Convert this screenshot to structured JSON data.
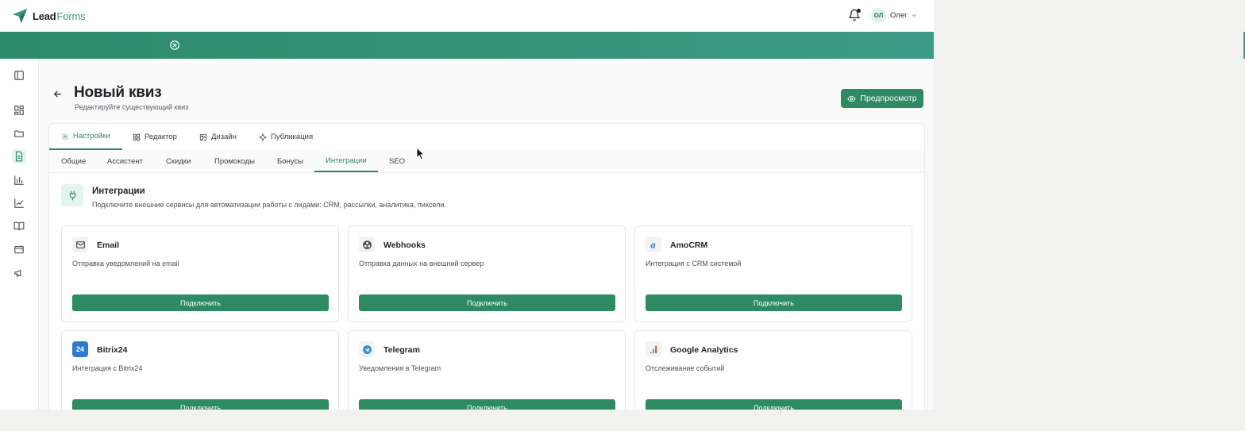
{
  "app": {
    "logo": {
      "part1": "Lead",
      "part2": "Forms"
    },
    "user": {
      "initials": "ОЛ",
      "name": "Олег"
    },
    "colors": {
      "accent": "#2e8a63",
      "banner": "#3b9b86"
    }
  },
  "sidebar": {
    "items": [
      {
        "icon": "sidebar-toggle-icon"
      },
      {
        "icon": "dashboard-icon"
      },
      {
        "icon": "folder-icon"
      },
      {
        "icon": "document-icon",
        "active": true
      },
      {
        "icon": "bar-chart-icon"
      },
      {
        "icon": "line-chart-icon"
      },
      {
        "icon": "book-icon"
      },
      {
        "icon": "wallet-icon"
      },
      {
        "icon": "megaphone-icon"
      }
    ]
  },
  "header": {
    "title": "Новый квиз",
    "subtitle": "Редактируйте существующий квиз",
    "preview_label": "Предпросмотр"
  },
  "tabs": [
    {
      "label": "Настройки",
      "icon": "gear-icon",
      "active": true
    },
    {
      "label": "Редактор",
      "icon": "grid-icon"
    },
    {
      "label": "Дизайн",
      "icon": "image-icon"
    },
    {
      "label": "Публикация",
      "icon": "publish-icon"
    }
  ],
  "subtabs": [
    {
      "label": "Общие"
    },
    {
      "label": "Ассистент"
    },
    {
      "label": "Скидки"
    },
    {
      "label": "Промокоды"
    },
    {
      "label": "Бонусы"
    },
    {
      "label": "Интеграции",
      "active": true
    },
    {
      "label": "SEO"
    }
  ],
  "section": {
    "title": "Интеграции",
    "description": "Подключите внешние сервисы для автоматизации работы с лидами: CRM, рассылки, аналитика, пиксели."
  },
  "integrations": [
    {
      "name": "Email",
      "description": "Отправка уведомлений на email",
      "button": "Подключить",
      "icon": "mail-icon"
    },
    {
      "name": "Webhooks",
      "description": "Отправка данных на внешний сервер",
      "button": "Подключить",
      "icon": "webhook-icon"
    },
    {
      "name": "AmoCRM",
      "description": "Интеграция с CRM системой",
      "button": "Подключить",
      "icon": "amocrm-icon"
    },
    {
      "name": "Bitrix24",
      "description": "Интеграция с Bitrix24",
      "button": "Подключить",
      "icon": "bitrix24-icon",
      "icon_text": "24"
    },
    {
      "name": "Telegram",
      "description": "Уведомления в Telegram",
      "button": "Подключить",
      "icon": "telegram-icon"
    },
    {
      "name": "Google Analytics",
      "description": "Отслеживание событий",
      "button": "Подключить",
      "icon": "google-analytics-icon"
    }
  ]
}
